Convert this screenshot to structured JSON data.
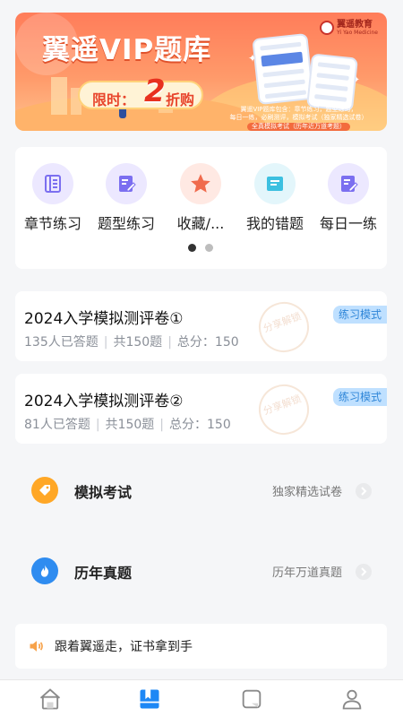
{
  "banner": {
    "title": "翼遥VIP题库",
    "promo_prefix": "限时：",
    "promo_number": "2",
    "promo_suffix": "折购",
    "brand_name": "翼遥教育",
    "brand_en": "Yi Yao Medicine",
    "desc_line1": "翼遥VIP题库包含：章节练习，题型练习，",
    "desc_line2": "每日一练，必刷测评，模拟考试（独家精选试卷）",
    "desc_line3": "全真模拟考试（历年近万道考题）"
  },
  "grid": {
    "items": [
      {
        "label": "章节练习",
        "icon": "chapter-icon",
        "bg": "#ece8ff",
        "color": "#7b6ff0"
      },
      {
        "label": "题型练习",
        "icon": "question-type-icon",
        "bg": "#ece8ff",
        "color": "#7b6ff0"
      },
      {
        "label": "收藏/...",
        "icon": "star-icon",
        "bg": "#ffe9e3",
        "color": "#f06b4d"
      },
      {
        "label": "我的错题",
        "icon": "wrong-questions-icon",
        "bg": "#e3f6fb",
        "color": "#3cc0e0"
      },
      {
        "label": "每日一练",
        "icon": "daily-practice-icon",
        "bg": "#ece8ff",
        "color": "#7b6ff0"
      }
    ],
    "page_dots": 2,
    "active_dot": 0
  },
  "exams": [
    {
      "title": "2024入学模拟测评卷①",
      "answered": "135人已答题",
      "count": "共150题",
      "score": "总分：150",
      "mode": "练习模式",
      "stamp": "分享解锁"
    },
    {
      "title": "2024入学模拟测评卷②",
      "answered": "81人已答题",
      "count": "共150题",
      "score": "总分：150",
      "mode": "练习模式",
      "stamp": "分享解锁"
    }
  ],
  "entries": [
    {
      "title": "模拟考试",
      "subtitle": "独家精选试卷",
      "icon": "tag-icon",
      "color": "#ffa726"
    },
    {
      "title": "历年真题",
      "subtitle": "历年万道真题",
      "icon": "flame-icon",
      "color": "#2f8cf0"
    }
  ],
  "notice": {
    "text": "跟着翼遥走，证书拿到手",
    "icon": "speaker-icon"
  },
  "tabbar": {
    "tabs": [
      {
        "icon": "home-icon",
        "active": false
      },
      {
        "icon": "question-bank-icon",
        "active": true
      },
      {
        "icon": "message-icon",
        "active": false
      },
      {
        "icon": "profile-icon",
        "active": false
      }
    ],
    "active_color": "#1e88f5",
    "inactive_color": "#8a8a8a"
  },
  "colors": {
    "page_bg": "#f5f6f8",
    "banner_orange": "#ff7d5a",
    "mode_tag_bg": "#bfe0ff",
    "mode_tag_text": "#2f86d8"
  }
}
